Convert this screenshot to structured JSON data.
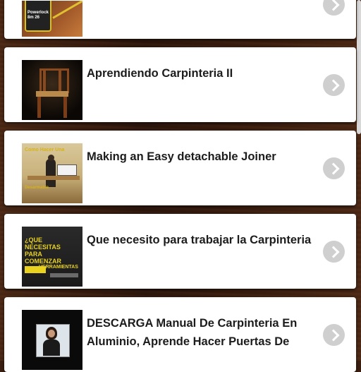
{
  "list": {
    "items": [
      {
        "title": "",
        "thumbnail": "tape-measure-thumbnail",
        "thumb_text": "Powerlock 8m 26"
      },
      {
        "title": "Aprendiendo Carpinteria II",
        "thumbnail": "wooden-chair-thumbnail",
        "thumb_text": ""
      },
      {
        "title": "Making an Easy detachable Joiner",
        "thumbnail": "joiner-workshop-thumbnail",
        "thumb_text": "Como Hacer Una",
        "thumb_text_2": "Desarmable"
      },
      {
        "title": "Que necesito para trabajar la Carpinteria",
        "thumbnail": "tools-thumbnail",
        "thumb_text": "¿QUE NECESITAS PARA COMENZAR",
        "thumb_text_2": "HERRAMIENTAS"
      },
      {
        "title": "DESCARGA Manual De Carpinteria En Aluminio, Aprende Hacer Puertas De",
        "thumbnail": "presenter-thumbnail",
        "thumb_text": ""
      }
    ]
  },
  "colors": {
    "card_bg": "#ffffff",
    "chevron_bg": "#cfcfcf",
    "title_text": "#1c1c1c",
    "background": "#3b1f10"
  },
  "icons": {
    "open": "chevron-right-icon"
  }
}
